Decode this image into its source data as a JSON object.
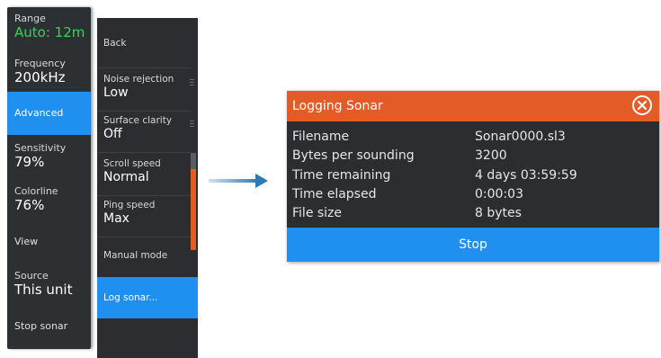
{
  "left_menu": {
    "range": {
      "label": "Range",
      "value": "Auto: 12m"
    },
    "frequency": {
      "label": "Frequency",
      "value": "200kHz"
    },
    "advanced": {
      "label": "Advanced"
    },
    "sensitivity": {
      "label": "Sensitivity",
      "value": "79%"
    },
    "colorline": {
      "label": "Colorline",
      "value": "76%"
    },
    "view": {
      "label": "View"
    },
    "source": {
      "label": "Source",
      "value": "This unit"
    },
    "stop_sonar": {
      "label": "Stop sonar"
    }
  },
  "sub_menu": {
    "back": {
      "label": "Back"
    },
    "noise_rejection": {
      "label": "Noise rejection",
      "value": "Low"
    },
    "surface_clarity": {
      "label": "Surface clarity",
      "value": "Off"
    },
    "scroll_speed": {
      "label": "Scroll speed",
      "value": "Normal"
    },
    "ping_speed": {
      "label": "Ping speed",
      "value": "Max"
    },
    "manual_mode": {
      "label": "Manual mode"
    },
    "log_sonar": {
      "label": "Log sonar..."
    }
  },
  "dialog": {
    "title": "Logging Sonar",
    "rows": [
      {
        "key": "Filename",
        "value": "Sonar0000.sl3"
      },
      {
        "key": "Bytes per sounding",
        "value": "3200"
      },
      {
        "key": "Time remaining",
        "value": "4 days 03:59:59"
      },
      {
        "key": "Time elapsed",
        "value": "0:00:03"
      },
      {
        "key": "File size",
        "value": "8 bytes"
      }
    ],
    "stop_label": "Stop",
    "close_icon": "close-circle-icon"
  },
  "colors": {
    "accent_blue": "#1f8ff0",
    "title_orange": "#e35c28",
    "menu_bg": "#2d3033",
    "range_green": "#39d353"
  },
  "icons": {
    "flow_arrow": "right-arrow-icon"
  }
}
